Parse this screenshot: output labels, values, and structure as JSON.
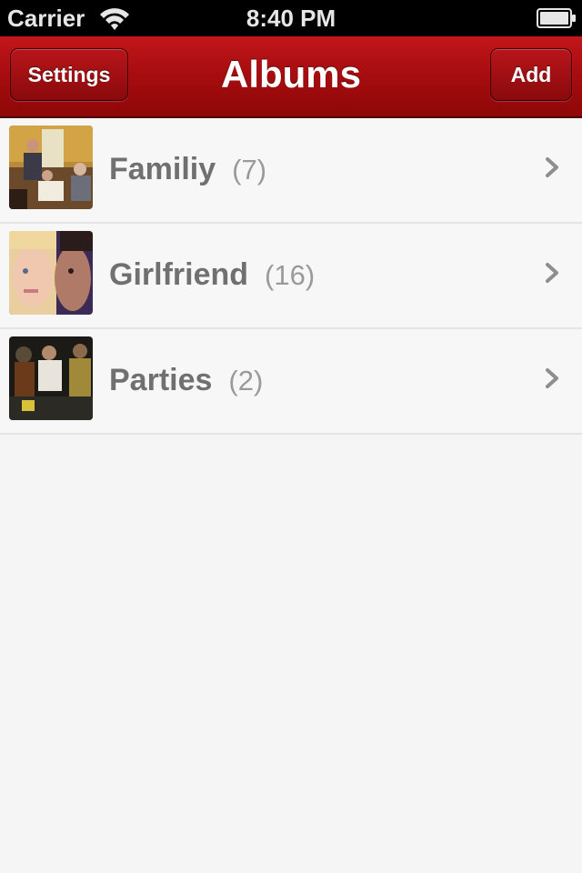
{
  "status_bar": {
    "carrier": "Carrier",
    "time": "8:40 PM",
    "icons": [
      "wifi-icon",
      "battery-icon"
    ]
  },
  "nav": {
    "title": "Albums",
    "left_button": "Settings",
    "right_button": "Add"
  },
  "albums": [
    {
      "name": "Familiy",
      "count": "(7)"
    },
    {
      "name": "Girlfriend",
      "count": "(16)"
    },
    {
      "name": "Parties",
      "count": "(2)"
    }
  ],
  "colors": {
    "nav_red": "#a80d10",
    "background": "#f5f5f5",
    "text_gray": "#707070"
  }
}
